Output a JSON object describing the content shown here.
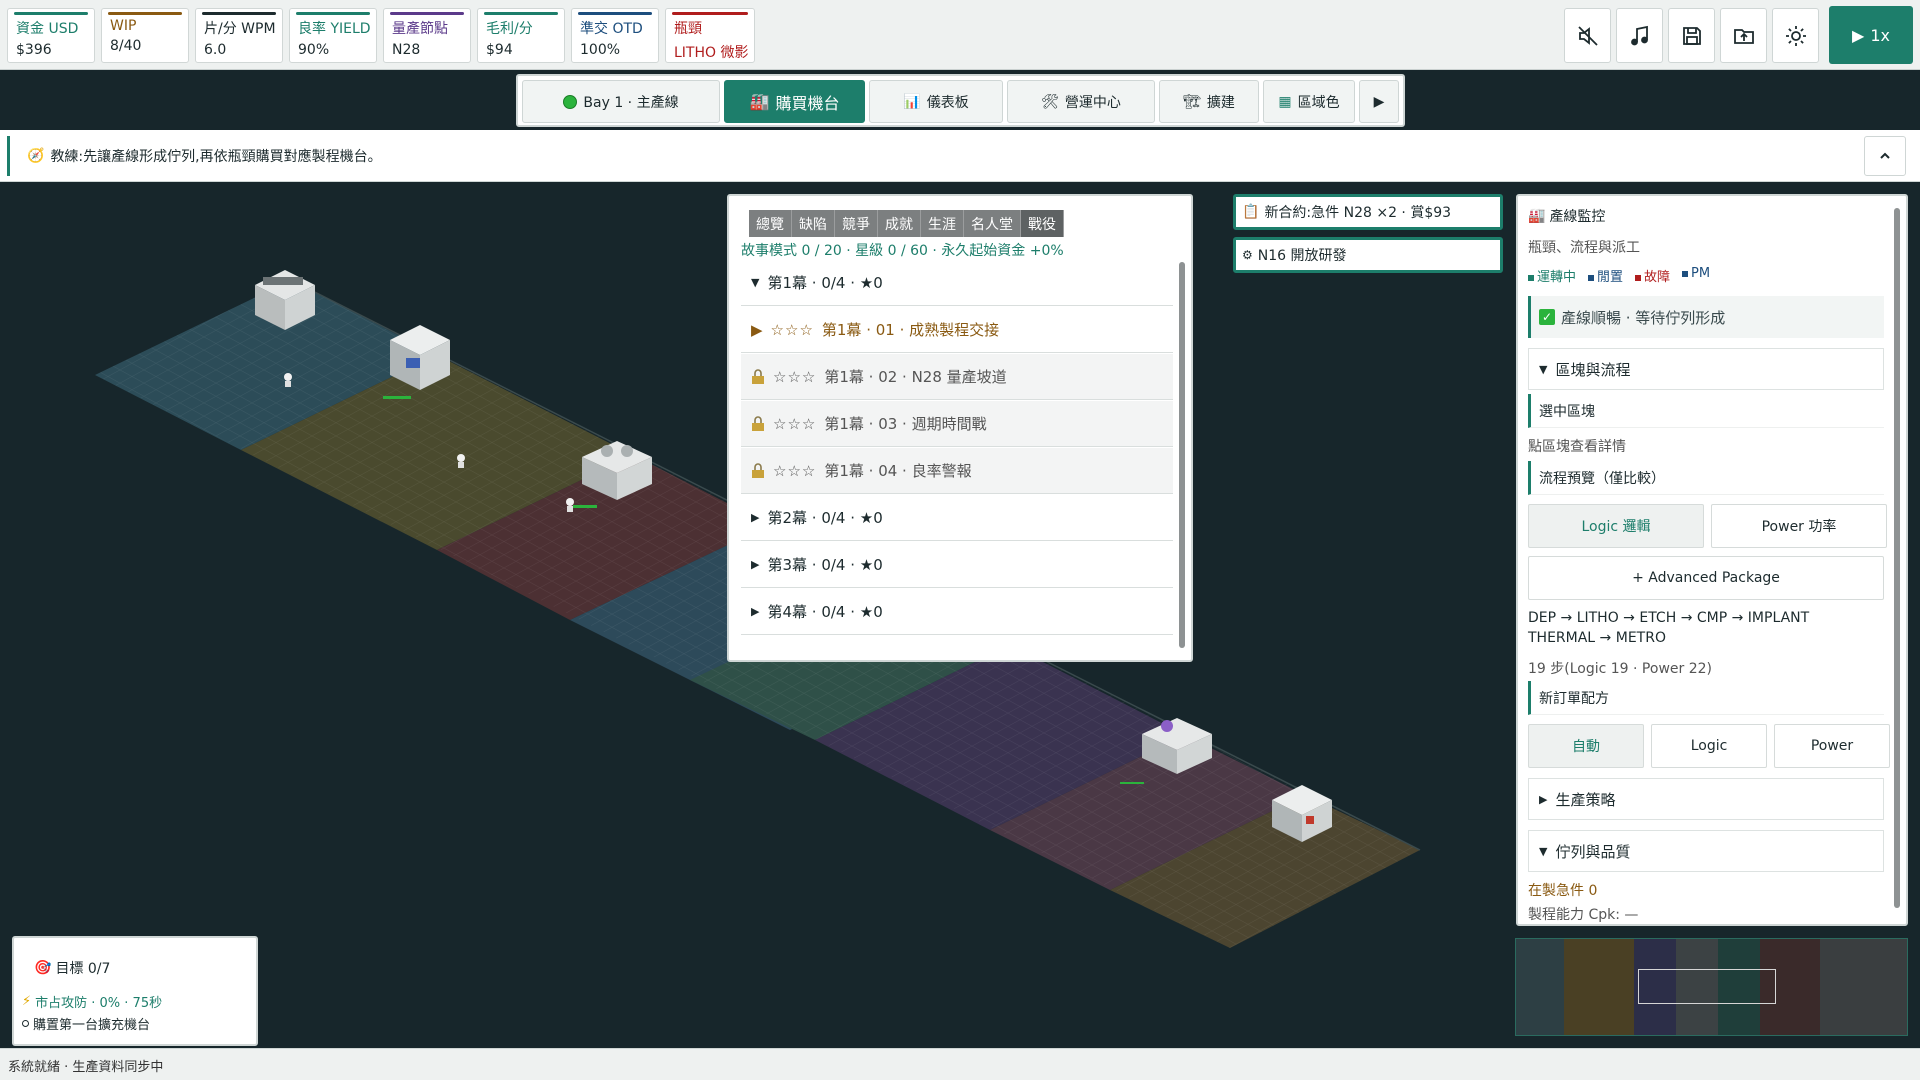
{
  "kpis": [
    {
      "label": "資金 USD",
      "value": "$396",
      "color": "#1d7e6b"
    },
    {
      "label": "WIP",
      "value": "8/40",
      "color": "#8a5a12"
    },
    {
      "label": "片/分 WPM",
      "value": "6.0",
      "color": "#1d2b2e"
    },
    {
      "label": "良率 YIELD",
      "value": "90%",
      "color": "#1d7e6b"
    },
    {
      "label": "量產節點",
      "value": "N28",
      "color": "#5b3a8a"
    },
    {
      "label": "毛利/分",
      "value": "$94",
      "color": "#1d7e6b"
    },
    {
      "label": "準交 OTD",
      "value": "100%",
      "color": "#1d4e7e"
    },
    {
      "label": "瓶頸",
      "value": "LITHO 微影",
      "color": "#b01d1d"
    }
  ],
  "toolbar": {
    "icons": [
      "mute-icon",
      "music-icon",
      "save-icon",
      "load-icon",
      "theme-icon"
    ],
    "speed_label": "1x"
  },
  "tabs": [
    {
      "label": "Bay 1 · 主產線",
      "icon": "green-dot-icon"
    },
    {
      "label": "購買機台",
      "icon": "factory-icon",
      "active": true
    },
    {
      "label": "儀表板",
      "icon": "chart-icon"
    },
    {
      "label": "營運中心",
      "icon": "tools-icon"
    },
    {
      "label": "擴建",
      "icon": "build-icon"
    },
    {
      "label": "區域色",
      "icon": "grid-icon"
    }
  ],
  "coach": {
    "text": "教練:先讓產線形成佇列,再依瓶頸購買對應製程機台。"
  },
  "campaign": {
    "tabs": [
      "總覽",
      "缺陷",
      "競爭",
      "成就",
      "生涯",
      "名人堂",
      "戰役"
    ],
    "active_tab": "戰役",
    "summary": "故事模式 0 / 20 · 星級 0 / 60 · 永久起始資金 +0%",
    "rows": [
      {
        "kind": "act",
        "label": "第1幕 · 0/4 · ★0",
        "expanded": true
      },
      {
        "kind": "mission-open",
        "stars": "☆☆☆",
        "label": "第1幕 · 01 · 成熟製程交接"
      },
      {
        "kind": "mission-locked",
        "stars": "☆☆☆",
        "label": "第1幕 · 02 · N28 量產坡道"
      },
      {
        "kind": "mission-locked",
        "stars": "☆☆☆",
        "label": "第1幕 · 03 · 週期時間戰"
      },
      {
        "kind": "mission-locked",
        "stars": "☆☆☆",
        "label": "第1幕 · 04 · 良率警報"
      },
      {
        "kind": "act",
        "label": "第2幕 · 0/4 · ★0",
        "expanded": false
      },
      {
        "kind": "act",
        "label": "第3幕 · 0/4 · ★0",
        "expanded": false
      },
      {
        "kind": "act",
        "label": "第4幕 · 0/4 · ★0",
        "expanded": false
      }
    ]
  },
  "contracts": [
    {
      "text": "新合約:急件 N28 ×2 · 賞$93"
    },
    {
      "text": "N16 開放研發"
    }
  ],
  "monitor": {
    "title": "產線監控",
    "subtitle": "瓶頸、流程與派工",
    "legend": [
      {
        "label": "運轉中",
        "color": "#1d7e6b"
      },
      {
        "label": "閒置",
        "color": "#1d4e7e"
      },
      {
        "label": "故障",
        "color": "#b01d1d"
      },
      {
        "label": "PM",
        "color": "#1d4e7e"
      }
    ],
    "status": "產線順暢 · 等待佇列形成",
    "section_area": "區塊與流程",
    "selected_block": "選中區塊",
    "block_hint": "點區塊查看詳情",
    "flow_preview": "流程預覽（僅比較）",
    "flow_buttons": [
      "Logic 邏輯",
      "Power 功率"
    ],
    "advanced_button": "+ Advanced Package",
    "flow_line1": "DEP → LITHO → ETCH → CMP → IMPLANT",
    "flow_line2": "THERMAL → METRO",
    "flow_steps": "19 步(Logic 19 · Power 22)",
    "new_order": "新訂單配方",
    "order_buttons": [
      "自動",
      "Logic",
      "Power"
    ],
    "section_strategy": "生產策略",
    "section_queue": "佇列與品質",
    "wip_urgent": "在製急件 0",
    "capability": "製程能力 Cpk: —"
  },
  "goals": {
    "title": "目標 0/7",
    "quest": "市占攻防 · 0% · 75秒",
    "task": "購置第一台擴充機台"
  },
  "status_bar": "系統就緒 · 生產資料同步中"
}
